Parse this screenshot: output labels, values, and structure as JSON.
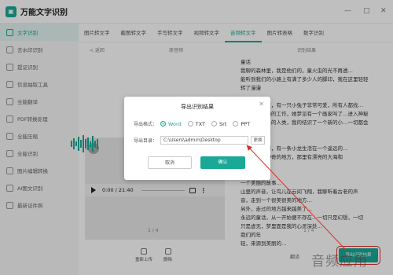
{
  "app": {
    "title": "万能文字识别",
    "logo_text": "▣"
  },
  "window_controls": {
    "minimize": "—",
    "maximize": "□",
    "close": "✕"
  },
  "sidebar": {
    "items": [
      {
        "label": "文字识别",
        "active": true
      },
      {
        "label": "去水印识别"
      },
      {
        "label": "提证识别"
      },
      {
        "label": "信息抽取工具"
      },
      {
        "label": "全能翻译"
      },
      {
        "label": "PDF转换处理"
      },
      {
        "label": "全能压缩"
      },
      {
        "label": "全能识别"
      },
      {
        "label": "图片编辑转换"
      },
      {
        "label": "AI图文识别"
      },
      {
        "label": "最新证件照"
      }
    ]
  },
  "tabs": [
    {
      "label": "图片转文字"
    },
    {
      "label": "截图转文字"
    },
    {
      "label": "手写转文字"
    },
    {
      "label": "视频转文字"
    },
    {
      "label": "音频转文字",
      "active": true
    },
    {
      "label": "图片转表格"
    },
    {
      "label": "数字识别"
    }
  ],
  "subbar": {
    "back": "< 返回",
    "left_title": "原音频",
    "right_title": "识别结果"
  },
  "player": {
    "time": "0:00 / 21:40",
    "more": "⋮"
  },
  "left_page": "1 / 4",
  "right_page": "1 / 4",
  "tools": [
    {
      "label": "重新上传"
    },
    {
      "label": "删除"
    }
  ],
  "result_lines": [
    "童话",
    "我聊的森林里，我是他们的，童火虫的光不再透…",
    "能听到我们的小路上有满了多少人的脚印，我在这里轻轻",
    "转了漫漫",
    "",
    "在一个神话里，有一只小兔子非常可爱，所有人都找…",
    "安叫一个普通的工作，她梦见有一个画家叫了…进入神秘",
    "的童话世界…的人类，我的结识了一个新的小…一切都会",
    "好起来的",
    "",
    "很久很久以前，有一条小龙生活在一个遥远的…",
    "到达了一个神奇的地方，那里有漂亮的大海和",
    "梦…",
    "",
    "一个美丽的故事…",
    "山里的声音，让鸟儿在云间飞翔，我聊听着古老的声",
    "音，走到一个很美很美的地方…",
    "另外，走过的地方越来越美了…",
    "永远的童话，从一开始便不存在…一切只是幻想，一切",
    "只是虚无，梦里面是我的心灵深处…",
    "我们的年",
    "轻，来源到美丽的…"
  ],
  "buttons": {
    "alt": "翻译",
    "export": "导出识别结果"
  },
  "watermark": "音频应用",
  "dialog": {
    "title": "导出识别结果",
    "close": "✕",
    "format_label": "导出格式：",
    "formats": [
      {
        "label": "Word",
        "selected": true
      },
      {
        "label": "TXT"
      },
      {
        "label": "Srt"
      },
      {
        "label": "PPT"
      }
    ],
    "dir_label": "导出目录：",
    "dir_value": "C:\\Users\\admin\\Desktop",
    "change": "更换",
    "cancel": "取消",
    "confirm": "确认"
  },
  "colors": {
    "accent": "#1aa897",
    "arrow": "#d93025"
  }
}
